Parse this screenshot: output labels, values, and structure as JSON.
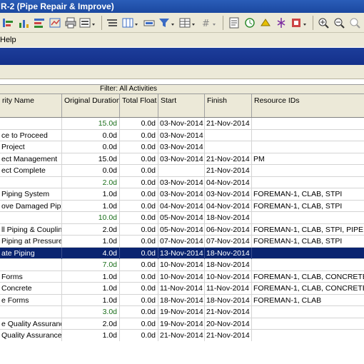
{
  "window": {
    "title": "R-2 (Pipe Repair & Improve)"
  },
  "menu": {
    "help": "Help"
  },
  "grid": {
    "filter_label": "Filter: All Activities",
    "columns": [
      "rity Name",
      "Original Duration",
      "Total Float",
      "Start",
      "Finish",
      "Resource IDs"
    ],
    "rows": [
      {
        "name": "",
        "duration": "15.0d",
        "float": "0.0d",
        "start": "03-Nov-2014",
        "finish": "21-Nov-2014",
        "resources": "",
        "summary": true
      },
      {
        "name": "ce to Proceed",
        "duration": "0.0d",
        "float": "0.0d",
        "start": "03-Nov-2014",
        "finish": "",
        "resources": ""
      },
      {
        "name": "Project",
        "duration": "0.0d",
        "float": "0.0d",
        "start": "03-Nov-2014",
        "finish": "",
        "resources": ""
      },
      {
        "name": "ect Management",
        "duration": "15.0d",
        "float": "0.0d",
        "start": "03-Nov-2014",
        "finish": "21-Nov-2014",
        "resources": "PM"
      },
      {
        "name": "ect Complete",
        "duration": "0.0d",
        "float": "0.0d",
        "start": "",
        "finish": "21-Nov-2014",
        "resources": ""
      },
      {
        "name": "",
        "duration": "2.0d",
        "float": "0.0d",
        "start": "03-Nov-2014",
        "finish": "04-Nov-2014",
        "resources": "",
        "summary": true
      },
      {
        "name": "Piping System",
        "duration": "1.0d",
        "float": "0.0d",
        "start": "03-Nov-2014",
        "finish": "03-Nov-2014",
        "resources": "FOREMAN-1, CLAB, STPI"
      },
      {
        "name": "ove Damaged Pipir",
        "duration": "1.0d",
        "float": "0.0d",
        "start": "04-Nov-2014",
        "finish": "04-Nov-2014",
        "resources": "FOREMAN-1, CLAB, STPI"
      },
      {
        "name": "",
        "duration": "10.0d",
        "float": "0.0d",
        "start": "05-Nov-2014",
        "finish": "18-Nov-2014",
        "resources": "",
        "summary": true
      },
      {
        "name": "ll Piping & Coupling",
        "duration": "2.0d",
        "float": "0.0d",
        "start": "05-Nov-2014",
        "finish": "06-Nov-2014",
        "resources": "FOREMAN-1, CLAB, STPI, PIPE, F"
      },
      {
        "name": "Piping at Pressure",
        "duration": "1.0d",
        "float": "0.0d",
        "start": "07-Nov-2014",
        "finish": "07-Nov-2014",
        "resources": "FOREMAN-1, CLAB, STPI"
      },
      {
        "name": "ate Piping",
        "duration": "4.0d",
        "float": "0.0d",
        "start": "13-Nov-2014",
        "finish": "18-Nov-2014",
        "resources": "",
        "selected": true
      },
      {
        "name": "",
        "duration": "7.0d",
        "float": "0.0d",
        "start": "10-Nov-2014",
        "finish": "18-Nov-2014",
        "resources": "",
        "summary": true
      },
      {
        "name": "Forms",
        "duration": "1.0d",
        "float": "0.0d",
        "start": "10-Nov-2014",
        "finish": "10-Nov-2014",
        "resources": "FOREMAN-1, CLAB, CONCRETE F"
      },
      {
        "name": "Concrete",
        "duration": "1.0d",
        "float": "0.0d",
        "start": "11-Nov-2014",
        "finish": "11-Nov-2014",
        "resources": "FOREMAN-1, CLAB, CONCRETE"
      },
      {
        "name": "e Forms",
        "duration": "1.0d",
        "float": "0.0d",
        "start": "18-Nov-2014",
        "finish": "18-Nov-2014",
        "resources": "FOREMAN-1, CLAB"
      },
      {
        "name": "",
        "duration": "3.0d",
        "float": "0.0d",
        "start": "19-Nov-2014",
        "finish": "21-Nov-2014",
        "resources": "",
        "summary": true
      },
      {
        "name": "e Quality Assurance",
        "duration": "2.0d",
        "float": "0.0d",
        "start": "19-Nov-2014",
        "finish": "20-Nov-2014",
        "resources": ""
      },
      {
        "name": "Quality Assurance",
        "duration": "1.0d",
        "float": "0.0d",
        "start": "21-Nov-2014",
        "finish": "21-Nov-2014",
        "resources": ""
      }
    ]
  },
  "toolbar_icons": [
    "activities-icon",
    "chart-icon",
    "resource-icon",
    "tracking-icon",
    "print-icon",
    "layout-icon",
    "group-icon",
    "columns-icon",
    "bar-icon",
    "filter-icon",
    "table-icon",
    "number-icon",
    "report-icon",
    "schedule-icon",
    "level-icon",
    "store-icon",
    "more-icon",
    "zoom-in-icon",
    "zoom-out-icon",
    "zoom-fit-icon"
  ],
  "colors": {
    "title": "#1b48a0",
    "band": "#14308a",
    "selection": "#0a2470",
    "summary_text": "#1a6e1a"
  }
}
